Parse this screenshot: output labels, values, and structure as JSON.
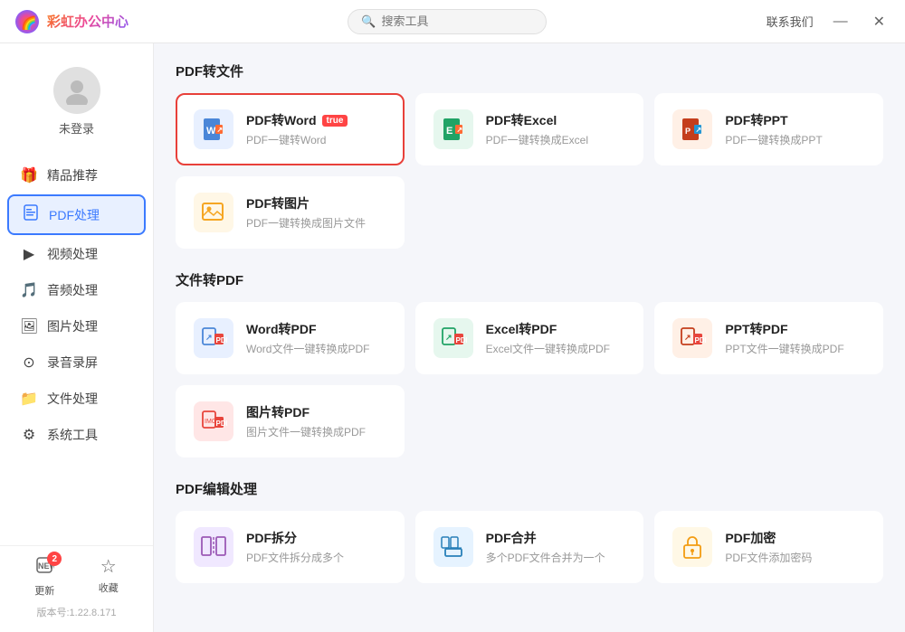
{
  "app": {
    "name": "彩虹办公中心",
    "version": "版本号:1.22.8.171"
  },
  "titlebar": {
    "search_placeholder": "搜索工具",
    "contact_label": "联系我们",
    "minimize_label": "—",
    "close_label": "✕"
  },
  "user": {
    "status": "未登录"
  },
  "sidebar": {
    "items": [
      {
        "id": "featured",
        "label": "精品推荐",
        "icon": "🎁"
      },
      {
        "id": "pdf",
        "label": "PDF处理",
        "icon": "📄",
        "active": true
      },
      {
        "id": "video",
        "label": "视频处理",
        "icon": "▶"
      },
      {
        "id": "audio",
        "label": "音频处理",
        "icon": "🎵"
      },
      {
        "id": "image",
        "label": "图片处理",
        "icon": "🖼"
      },
      {
        "id": "record",
        "label": "录音录屏",
        "icon": "⊙"
      },
      {
        "id": "file",
        "label": "文件处理",
        "icon": "📁"
      },
      {
        "id": "system",
        "label": "系统工具",
        "icon": "⚙"
      }
    ],
    "bottom": {
      "update_label": "更新",
      "update_badge": "2",
      "favorite_label": "收藏",
      "version": "版本号:1.22.8.171"
    }
  },
  "content": {
    "sections": [
      {
        "id": "pdf_to_file",
        "title": "PDF转文件",
        "tools": [
          {
            "id": "pdf_to_word",
            "name": "PDF转Word",
            "desc": "PDF一键转Word",
            "hot": true,
            "selected": true,
            "icon_type": "word"
          },
          {
            "id": "pdf_to_excel",
            "name": "PDF转Excel",
            "desc": "PDF一键转换成Excel",
            "hot": false,
            "selected": false,
            "icon_type": "excel"
          },
          {
            "id": "pdf_to_ppt",
            "name": "PDF转PPT",
            "desc": "PDF一键转换成PPT",
            "hot": false,
            "selected": false,
            "icon_type": "ppt"
          },
          {
            "id": "pdf_to_image",
            "name": "PDF转图片",
            "desc": "PDF一键转换成图片文件",
            "hot": false,
            "selected": false,
            "icon_type": "image"
          }
        ]
      },
      {
        "id": "file_to_pdf",
        "title": "文件转PDF",
        "tools": [
          {
            "id": "word_to_pdf",
            "name": "Word转PDF",
            "desc": "Word文件一键转换成PDF",
            "hot": false,
            "selected": false,
            "icon_type": "word2pdf"
          },
          {
            "id": "excel_to_pdf",
            "name": "Excel转PDF",
            "desc": "Excel文件一键转换成PDF",
            "hot": false,
            "selected": false,
            "icon_type": "excel2pdf"
          },
          {
            "id": "ppt_to_pdf",
            "name": "PPT转PDF",
            "desc": "PPT文件一键转换成PDF",
            "hot": false,
            "selected": false,
            "icon_type": "ppt2pdf"
          },
          {
            "id": "img_to_pdf",
            "name": "图片转PDF",
            "desc": "图片文件一键转换成PDF",
            "hot": false,
            "selected": false,
            "icon_type": "img2pdf"
          }
        ]
      },
      {
        "id": "pdf_edit",
        "title": "PDF编辑处理",
        "tools": [
          {
            "id": "pdf_split",
            "name": "PDF拆分",
            "desc": "PDF文件拆分成多个",
            "hot": false,
            "selected": false,
            "icon_type": "split"
          },
          {
            "id": "pdf_merge",
            "name": "PDF合并",
            "desc": "多个PDF文件合并为一个",
            "hot": false,
            "selected": false,
            "icon_type": "merge"
          },
          {
            "id": "pdf_encrypt",
            "name": "PDF加密",
            "desc": "PDF文件添加密码",
            "hot": false,
            "selected": false,
            "icon_type": "encrypt"
          }
        ]
      }
    ]
  }
}
